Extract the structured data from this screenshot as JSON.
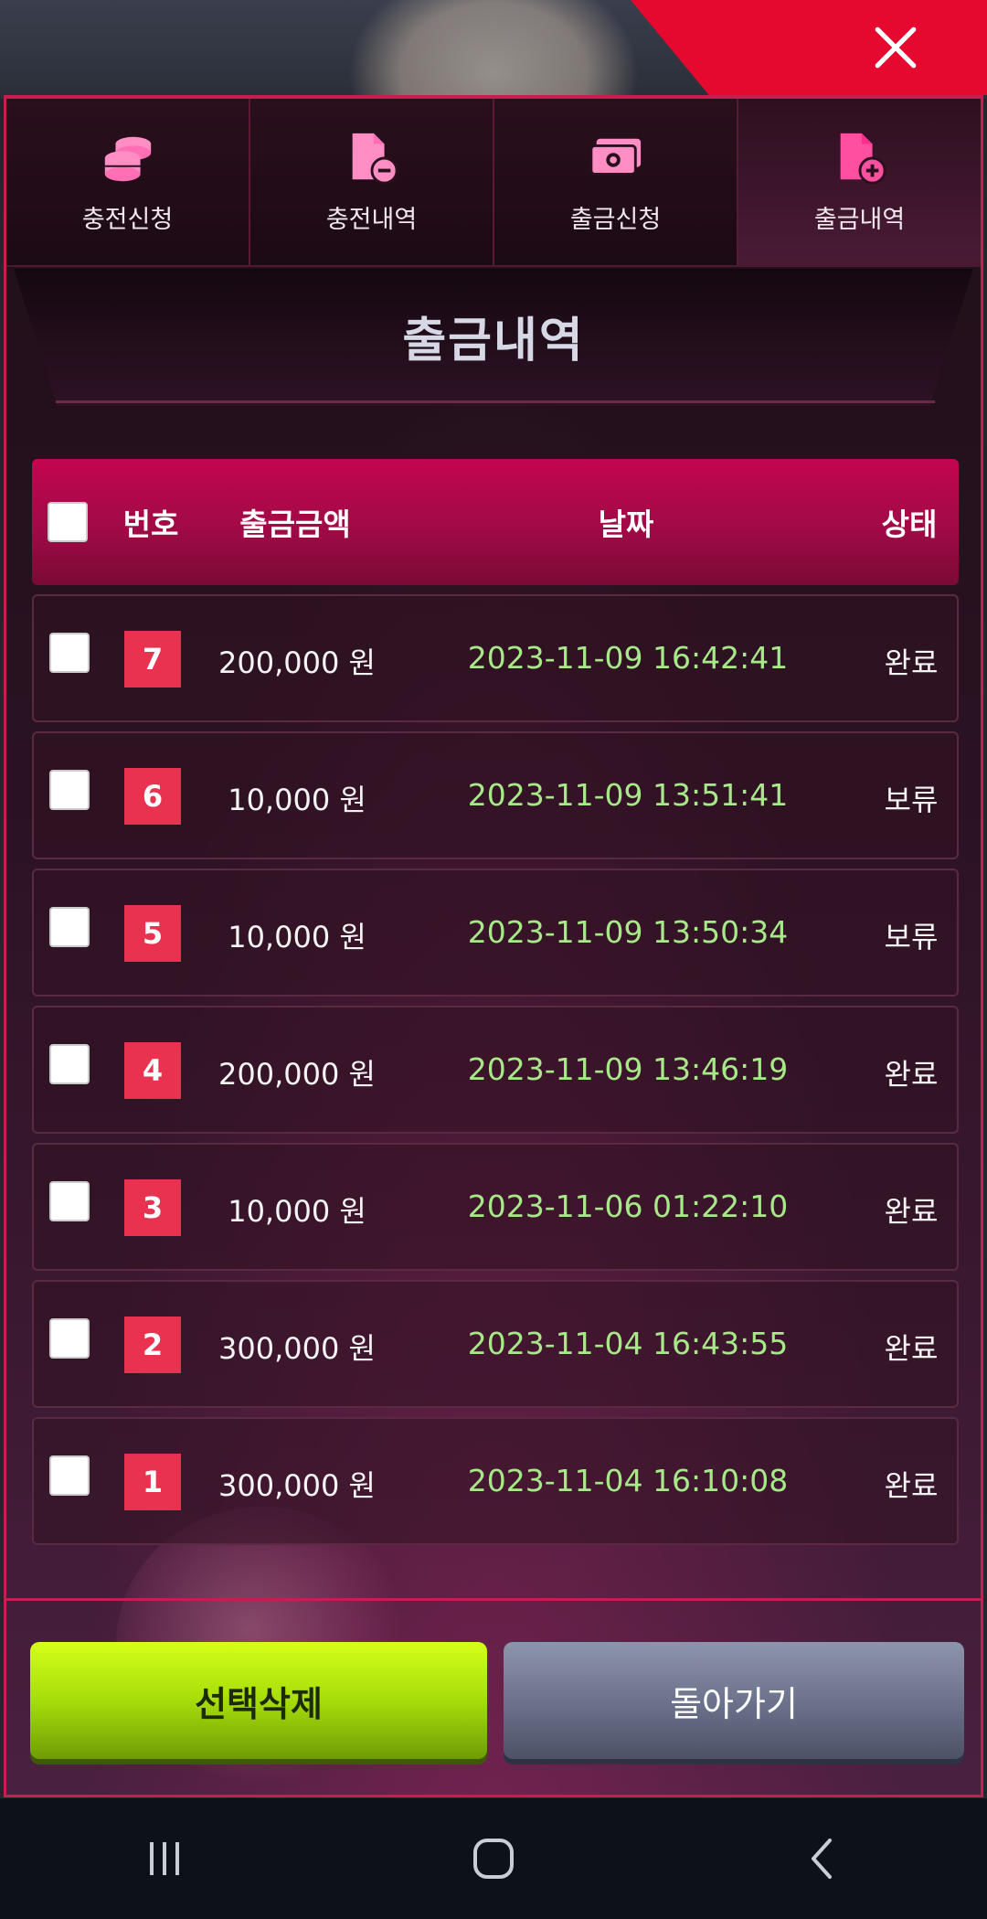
{
  "tabs": [
    {
      "label": "충전신청",
      "icon": "coins-icon"
    },
    {
      "label": "충전내역",
      "icon": "document-minus-icon"
    },
    {
      "label": "출금신청",
      "icon": "cash-icon"
    },
    {
      "label": "출금내역",
      "icon": "document-plus-icon",
      "active": true
    }
  ],
  "page": {
    "title": "출금내역"
  },
  "table": {
    "headers": {
      "no": "번호",
      "amount": "출금금액",
      "date": "날짜",
      "status": "상태"
    },
    "rows": [
      {
        "no": "7",
        "amount": "200,000 원",
        "date": "2023-11-09 16:42:41",
        "status": "완료"
      },
      {
        "no": "6",
        "amount": "10,000 원",
        "date": "2023-11-09 13:51:41",
        "status": "보류"
      },
      {
        "no": "5",
        "amount": "10,000 원",
        "date": "2023-11-09 13:50:34",
        "status": "보류"
      },
      {
        "no": "4",
        "amount": "200,000 원",
        "date": "2023-11-09 13:46:19",
        "status": "완료"
      },
      {
        "no": "3",
        "amount": "10,000 원",
        "date": "2023-11-06 01:22:10",
        "status": "완료"
      },
      {
        "no": "2",
        "amount": "300,000 원",
        "date": "2023-11-04 16:43:55",
        "status": "완료"
      },
      {
        "no": "1",
        "amount": "300,000 원",
        "date": "2023-11-04 16:10:08",
        "status": "완료"
      }
    ]
  },
  "buttons": {
    "delete": "선택삭제",
    "back": "돌아가기"
  },
  "colors": {
    "accent": "#e50930",
    "header_pink": "#c3064f",
    "badge_red": "#e8324f",
    "date_green": "#a7e889",
    "delete_green": "#a7dd0a",
    "back_gray": "#6a7089"
  }
}
